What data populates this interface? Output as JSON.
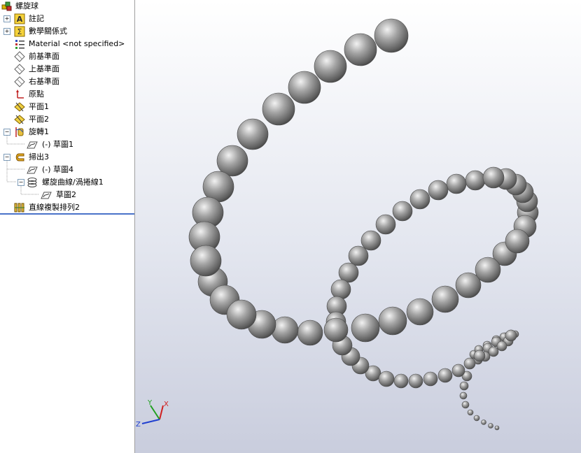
{
  "feature_tree": {
    "part_name": "螺旋球",
    "annotations": "註記",
    "equations": "數學關係式",
    "material": "Material <not specified>",
    "front_plane": "前基準面",
    "top_plane": "上基準面",
    "right_plane": "右基準面",
    "origin": "原點",
    "plane1": "平面1",
    "plane2": "平面2",
    "revolve1": "旋轉1",
    "revolve1_sketch": "(-) 草圖1",
    "sweep3": "掃出3",
    "sweep3_sketch": "(-) 草圖4",
    "helix1": "螺旋曲線/渦捲線1",
    "helix1_sketch": "草圖2",
    "linear_pattern2": "直線複製排列2",
    "expand_collapse_symbols": {
      "plus": "+",
      "minus": "−"
    }
  },
  "icons": {
    "part": "part-icon",
    "annotations": "annotations-icon",
    "equations": "equations-icon",
    "material": "material-icon",
    "plane": "plane-icon",
    "origin": "origin-icon",
    "ref_plane": "reference-plane-icon",
    "revolve": "revolve-icon",
    "sketch": "sketch-icon",
    "sweep": "sweep-icon",
    "helix": "helix-icon",
    "pattern": "linear-pattern-icon"
  },
  "splitter": {
    "handle_glyph": "‹"
  },
  "triad": {
    "x_label": "X",
    "y_label": "Y",
    "z_label": "Z"
  },
  "colors": {
    "viewport_top": "#ffffff",
    "viewport_bottom": "#c9cddd",
    "sphere_base": "#8a8a8a",
    "selection_line": "#4a72c9",
    "axis_x": "#d02020",
    "axis_y": "#20a020",
    "axis_z": "#2040d0"
  }
}
